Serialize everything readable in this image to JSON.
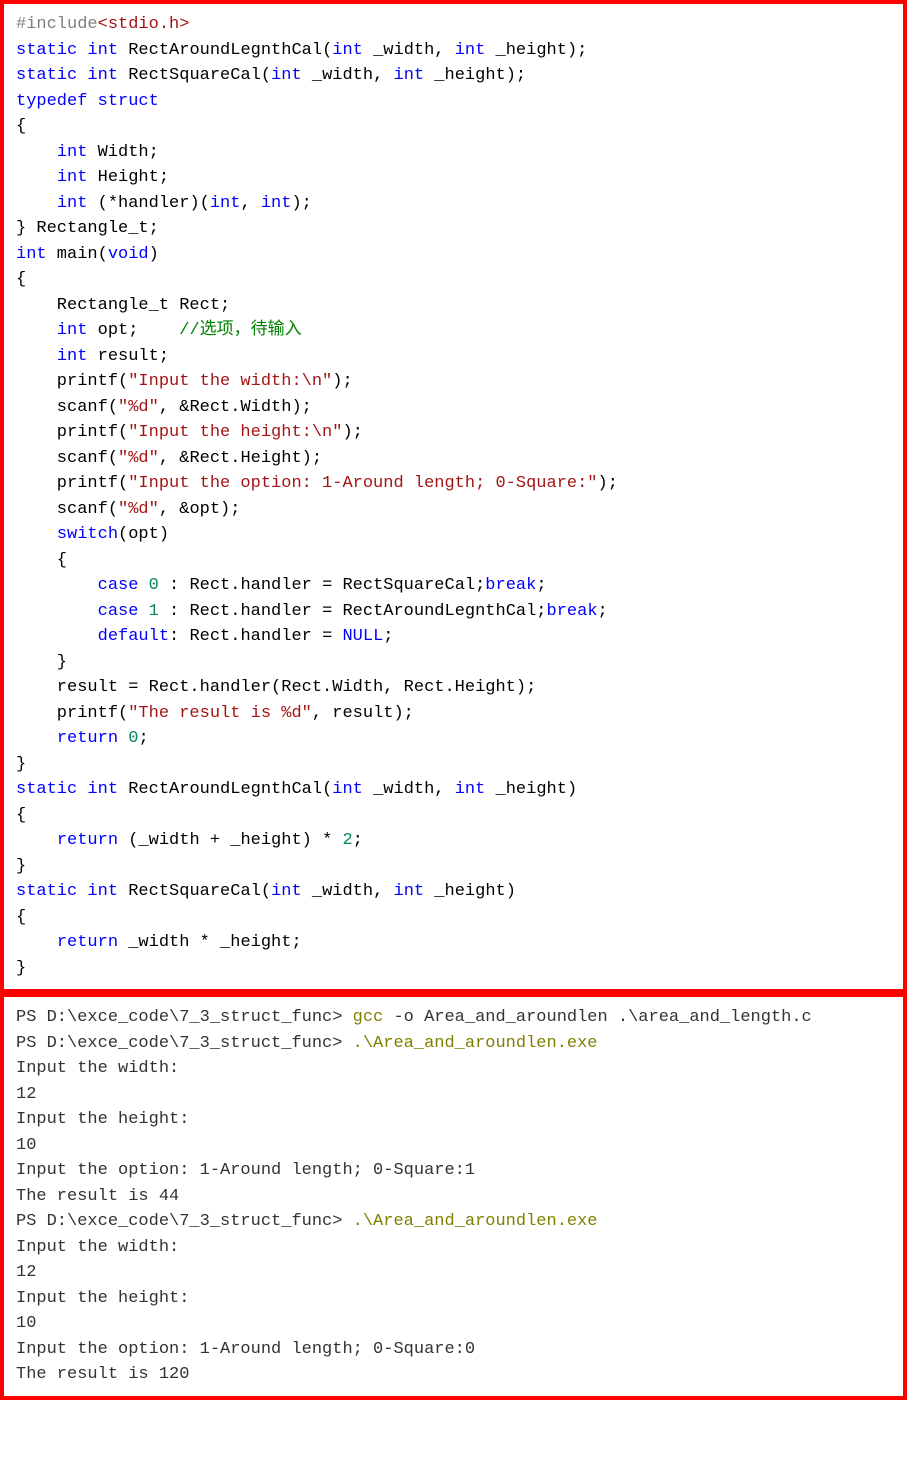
{
  "code": {
    "l1_pp": "#include",
    "l1_inc": "<stdio.h>",
    "l2_kw1": "static",
    "l2_kw2": "int",
    "l2_fn": " RectAroundLegnthCal(",
    "l2_kw3": "int",
    "l2_p1": " _width, ",
    "l2_kw4": "int",
    "l2_p2": " _height);",
    "l3_kw1": "static",
    "l3_kw2": "int",
    "l3_fn": " RectSquareCal(",
    "l3_kw3": "int",
    "l3_p1": " _width, ",
    "l3_kw4": "int",
    "l3_p2": " _height);",
    "l4_kw1": "typedef",
    "l4_kw2": "struct",
    "l5": "{",
    "l6_kw": "int",
    "l6_id": " Width;",
    "l7_kw": "int",
    "l7_id": " Height;",
    "l8_kw1": "int",
    "l8_p1": " (*handler)(",
    "l8_kw2": "int",
    "l8_p2": ", ",
    "l8_kw3": "int",
    "l8_p3": ");",
    "l9": "} Rectangle_t;",
    "l10_kw1": "int",
    "l10_fn": " main(",
    "l10_kw2": "void",
    "l10_p": ")",
    "l11": "{",
    "l12": "    Rectangle_t Rect;",
    "l13_kw": "int",
    "l13_id": " opt;    ",
    "l13_cmt": "//选项，待输入",
    "l14_kw": "int",
    "l14_id": " result;",
    "l15_fn": "    printf(",
    "l15_str": "\"Input the width:\\n\"",
    "l15_p": ");",
    "l16_fn": "    scanf(",
    "l16_str": "\"%d\"",
    "l16_p": ", &Rect.Width);",
    "l17_fn": "    printf(",
    "l17_str": "\"Input the height:\\n\"",
    "l17_p": ");",
    "l18_fn": "    scanf(",
    "l18_str": "\"%d\"",
    "l18_p": ", &Rect.Height);",
    "l19_fn": "    printf(",
    "l19_str": "\"Input the option: 1-Around length; 0-Square:\"",
    "l19_p": ");",
    "l20_fn": "    scanf(",
    "l20_str": "\"%d\"",
    "l20_p": ", &opt);",
    "l21_kw": "switch",
    "l21_p": "(opt)",
    "l22": "    {",
    "l23_kw1": "case",
    "l23_num": "0",
    "l23_p1": " : Rect.handler = RectSquareCal;",
    "l23_kw2": "break",
    "l23_p2": ";",
    "l24_kw1": "case",
    "l24_num": "1",
    "l24_p1": " : Rect.handler = RectAroundLegnthCal;",
    "l24_kw2": "break",
    "l24_p2": ";",
    "l25_kw": "default",
    "l25_p1": ": Rect.handler = ",
    "l25_mac": "NULL",
    "l25_p2": ";",
    "l26": "    }",
    "l27": "    result = Rect.handler(Rect.Width, Rect.Height);",
    "l28_fn": "    printf(",
    "l28_str": "\"The result is %d\"",
    "l28_p": ", result);",
    "l29_kw": "return",
    "l29_num": "0",
    "l29_p": ";",
    "l30": "}",
    "l31_kw1": "static",
    "l31_kw2": "int",
    "l31_fn": " RectAroundLegnthCal(",
    "l31_kw3": "int",
    "l31_p1": " _width, ",
    "l31_kw4": "int",
    "l31_p2": " _height)",
    "l32": "{",
    "l33_kw": "return",
    "l33_p1": " (_width + _height) * ",
    "l33_num": "2",
    "l33_p2": ";",
    "l34": "}",
    "l35_kw1": "static",
    "l35_kw2": "int",
    "l35_fn": " RectSquareCal(",
    "l35_kw3": "int",
    "l35_p1": " _width, ",
    "l35_kw4": "int",
    "l35_p2": " _height)",
    "l36": "{",
    "l37_kw": "return",
    "l37_p": " _width * _height;",
    "l38": "}"
  },
  "terminal": {
    "t1_prompt": "PS D:\\exce_code\\7_3_struct_func> ",
    "t1_cmd": "gcc",
    "t1_args": " -o Area_and_aroundlen .\\area_and_length.c",
    "t2_prompt": "PS D:\\exce_code\\7_3_struct_func> ",
    "t2_cmd": ".\\Area_and_aroundlen.exe",
    "t3": "Input the width:",
    "t4": "12",
    "t5": "Input the height:",
    "t6": "10",
    "t7": "Input the option: 1-Around length; 0-Square:1",
    "t8": "The result is 44",
    "t9_prompt": "PS D:\\exce_code\\7_3_struct_func> ",
    "t9_cmd": ".\\Area_and_aroundlen.exe",
    "t10": "Input the width:",
    "t11": "12",
    "t12": "Input the height:",
    "t13": "10",
    "t14": "Input the option: 1-Around length; 0-Square:0",
    "t15": "The result is 120"
  }
}
